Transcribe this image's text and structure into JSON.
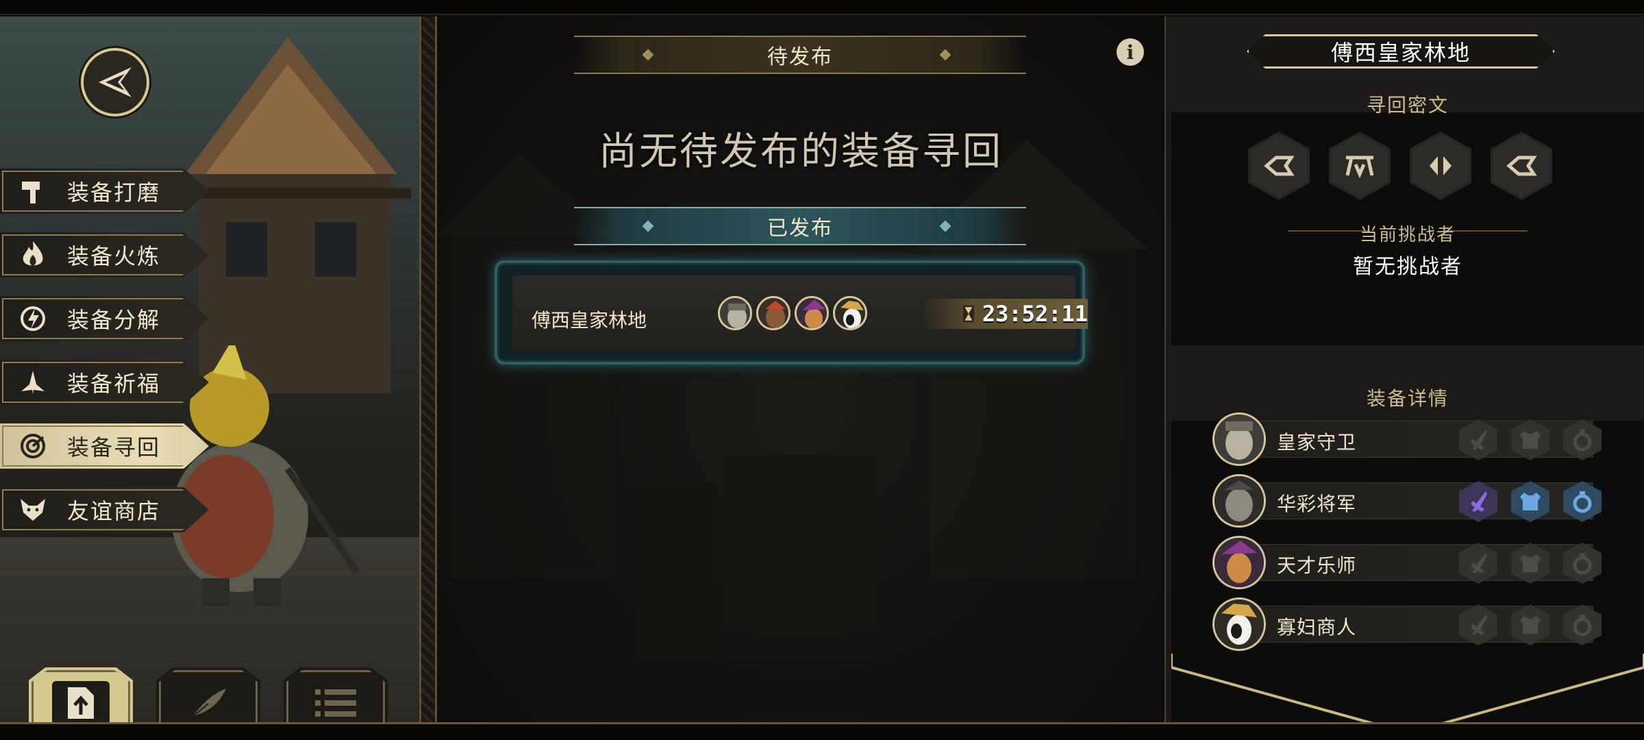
{
  "menu": {
    "items": [
      {
        "label": "装备打磨",
        "icon": "hammer-icon",
        "active": false
      },
      {
        "label": "装备火炼",
        "icon": "flame-icon",
        "active": false
      },
      {
        "label": "装备分解",
        "icon": "disassemble-icon",
        "active": false
      },
      {
        "label": "装备祈福",
        "icon": "praying-hands-icon",
        "active": false
      },
      {
        "label": "装备寻回",
        "icon": "target-icon",
        "active": true
      },
      {
        "label": "友谊商店",
        "icon": "fox-icon",
        "active": false
      }
    ]
  },
  "bottom_tabs": [
    {
      "icon": "upload-file-icon",
      "active": true
    },
    {
      "icon": "quill-icon",
      "active": false
    },
    {
      "icon": "list-icon",
      "active": false
    }
  ],
  "center": {
    "pending_header": "待发布",
    "empty_message": "尚无待发布的装备寻回",
    "published_header": "已发布",
    "quest": {
      "location": "傅西皇家林地",
      "portraits": [
        "royal-guard-portrait",
        "general-portrait",
        "bard-portrait",
        "widow-merchant-portrait"
      ],
      "timer": "23:52:11"
    }
  },
  "right": {
    "location_title": "傅西皇家林地",
    "cipher_heading": "寻回密文",
    "runes": [
      "rune-1-icon",
      "rune-2-icon",
      "rune-3-icon",
      "rune-4-icon"
    ],
    "challenger_label": "当前挑战者",
    "challenger_value": "暂无挑战者",
    "equip_heading": "装备详情",
    "equipment": [
      {
        "name": "皇家守卫",
        "slots_filled": [
          false,
          false,
          false
        ]
      },
      {
        "name": "华彩将军",
        "slots_filled": [
          true,
          true,
          true
        ]
      },
      {
        "name": "天才乐师",
        "slots_filled": [
          false,
          false,
          false
        ]
      },
      {
        "name": "寡妇商人",
        "slots_filled": [
          false,
          false,
          false
        ]
      }
    ]
  },
  "colors": {
    "gold": "#d7cba0",
    "teal": "#2f5f62",
    "slot_active": "#5a8fc4",
    "slot_sword_active": "#7a5ac8"
  }
}
